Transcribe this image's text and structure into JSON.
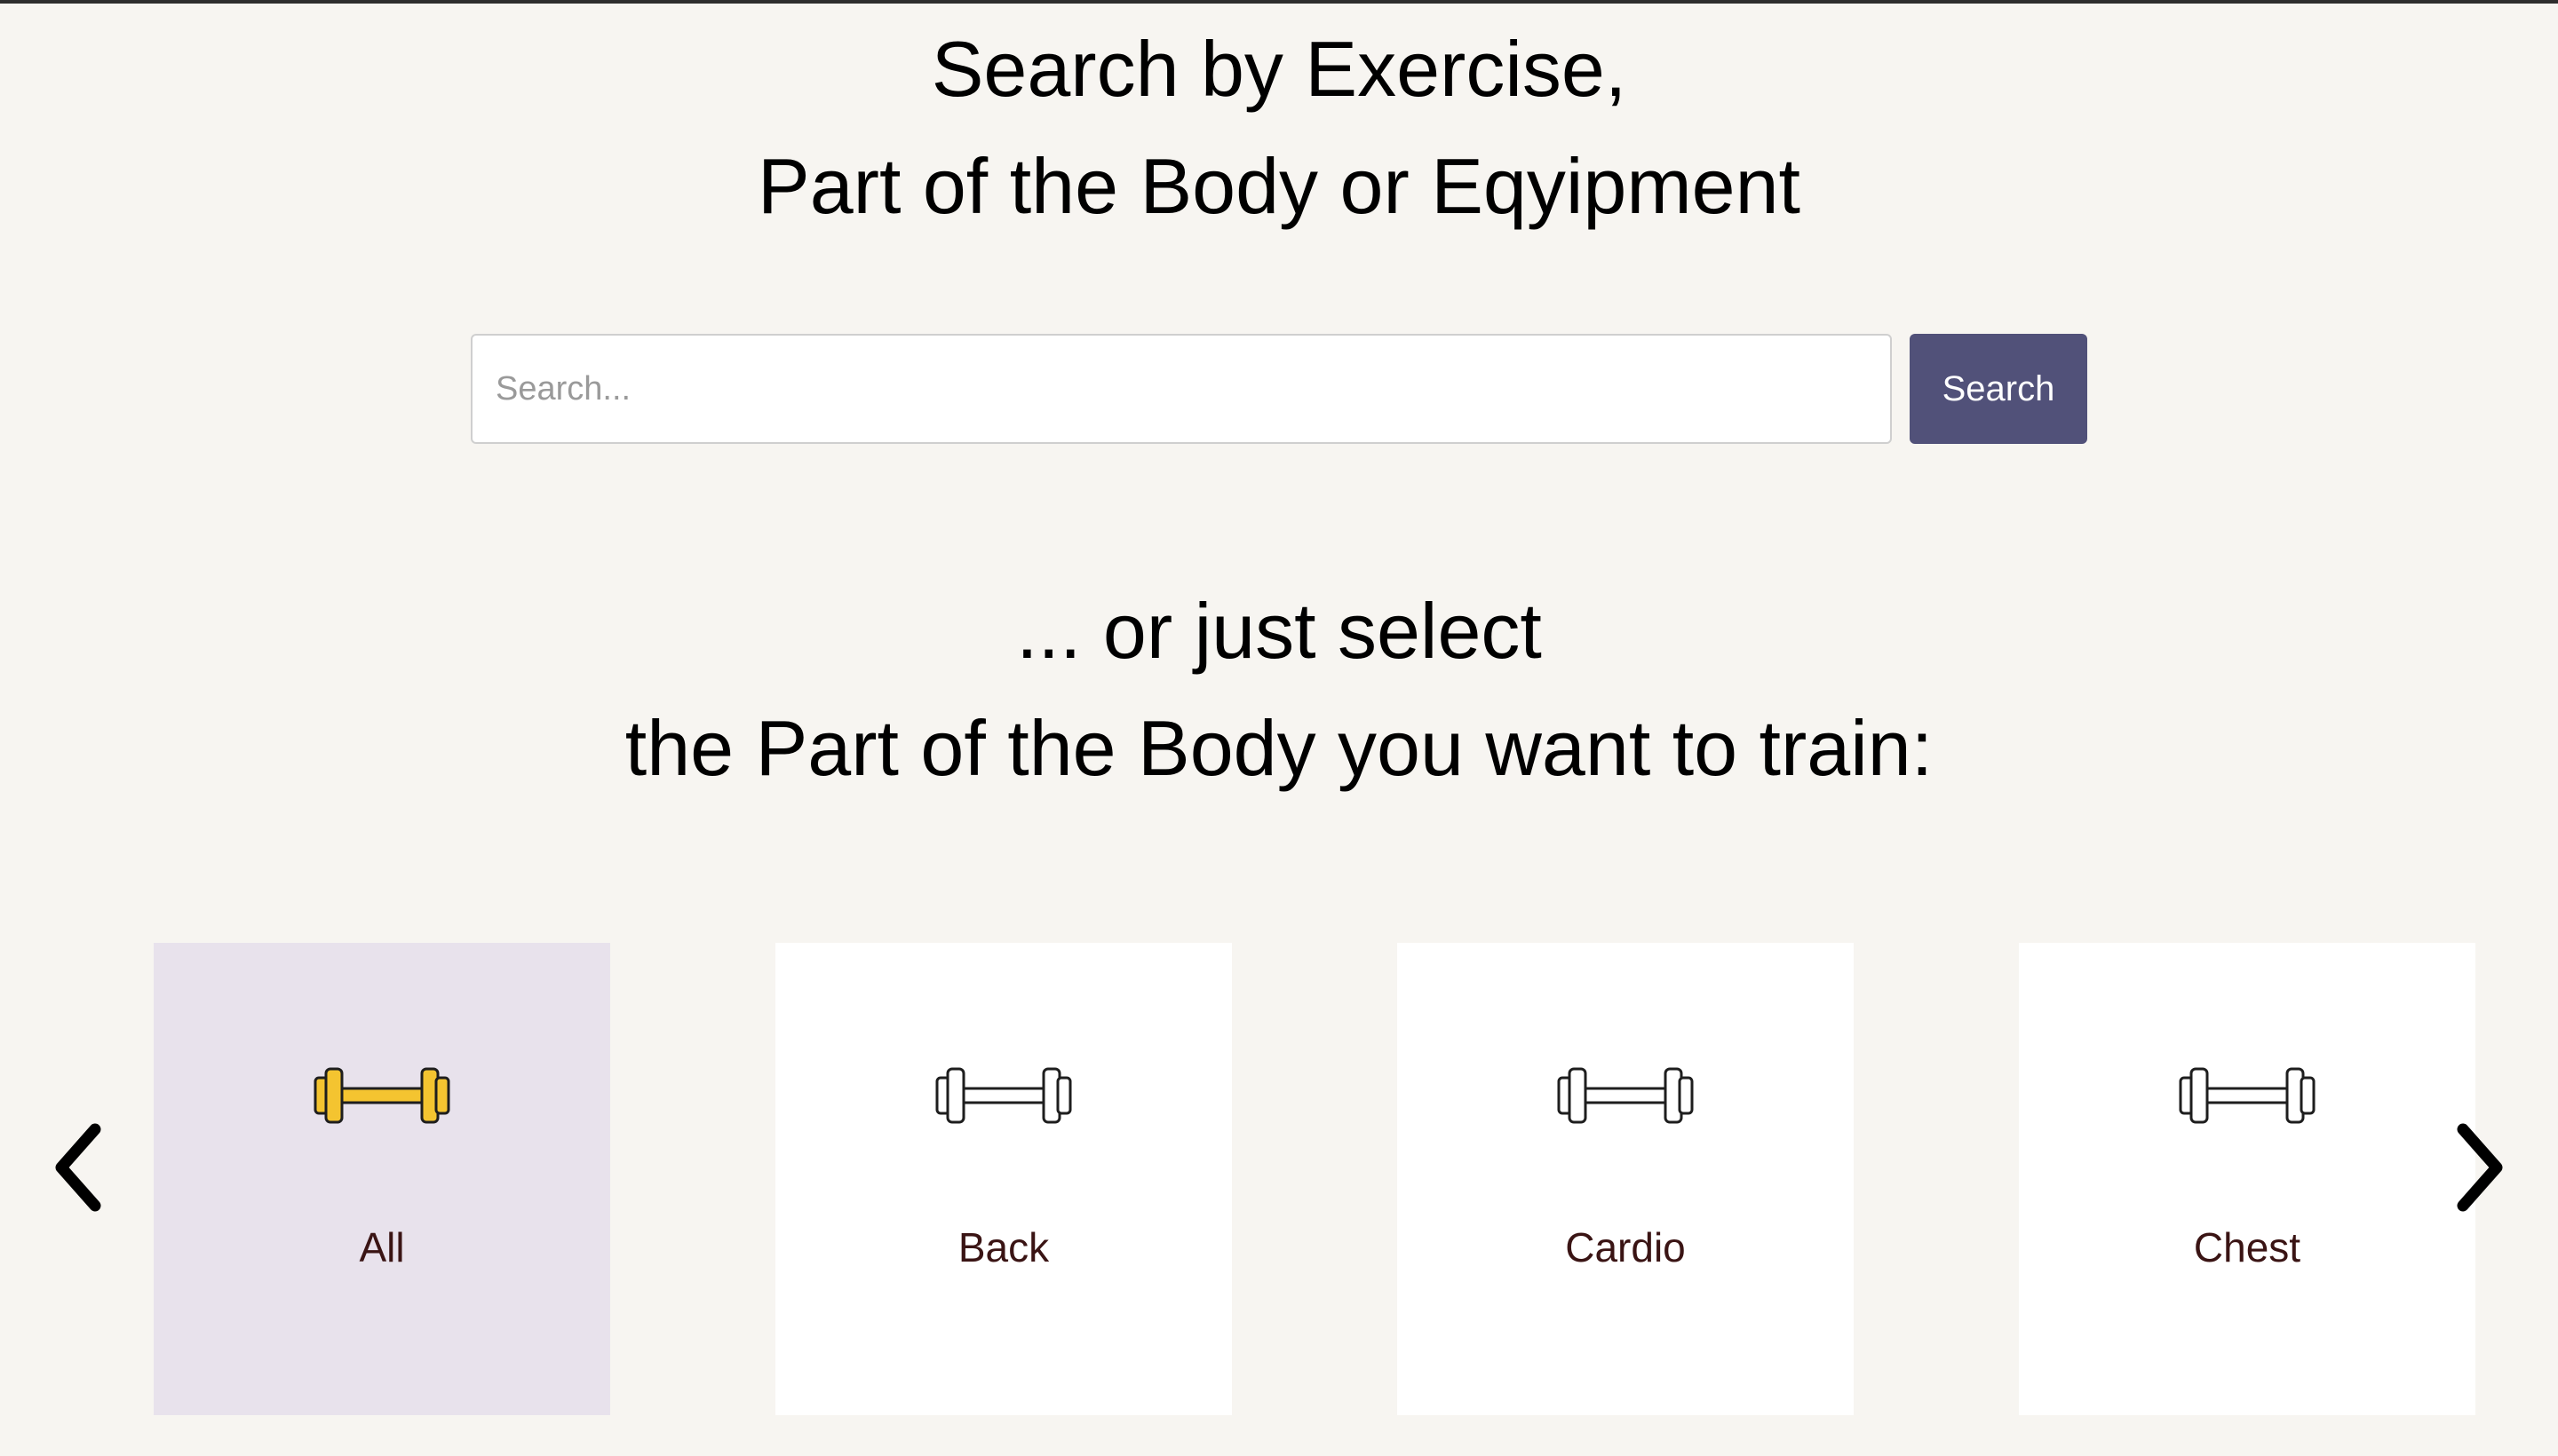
{
  "header": {
    "title_line1": "Search by Exercise,",
    "title_line2": "Part of the Body or Eqyipment"
  },
  "search": {
    "placeholder": "Search...",
    "value": "",
    "button_label": "Search",
    "button_color": "#515179"
  },
  "select_prompt": {
    "line1": "... or just select",
    "line2": "the Part of the Body you want to train:"
  },
  "carousel": {
    "prev_icon": "chevron-left-icon",
    "next_icon": "chevron-right-icon",
    "items": [
      {
        "label": "All",
        "icon": "dumbbell-icon",
        "selected": true,
        "icon_color": "#f4c430"
      },
      {
        "label": "Back",
        "icon": "dumbbell-icon",
        "selected": false,
        "icon_color": "#ffffff"
      },
      {
        "label": "Cardio",
        "icon": "dumbbell-icon",
        "selected": false,
        "icon_color": "#ffffff"
      },
      {
        "label": "Chest",
        "icon": "dumbbell-icon",
        "selected": false,
        "icon_color": "#ffffff"
      }
    ]
  }
}
